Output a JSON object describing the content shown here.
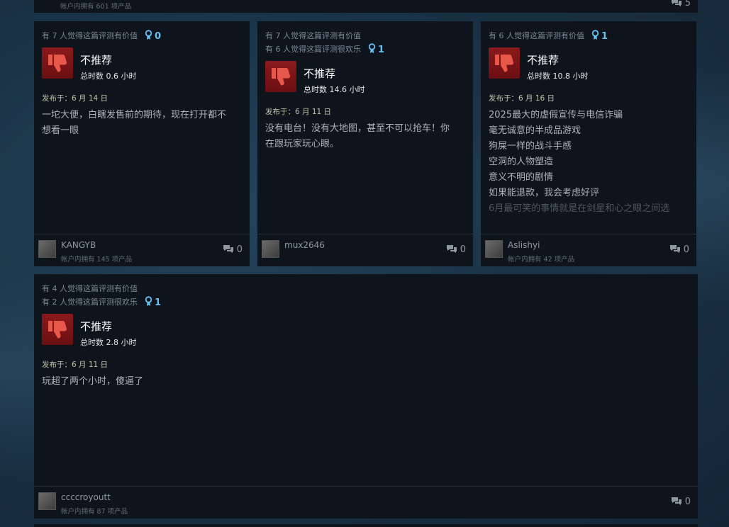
{
  "top_strip": {
    "owned": "帐户内拥有 601 项产品",
    "comment_count": "5"
  },
  "reviews": [
    {
      "helpful": "有 7 人觉得这篇评测有价值",
      "funny": "",
      "awards": "0",
      "verdict": "不推荐",
      "hours": "总时数 0.6 小时",
      "posted": "发布于：6 月 14 日",
      "lines": [
        "一坨大便，白瞎发售前的期待，现在打开都不",
        "想看一眼"
      ],
      "user": "KANGYB",
      "owned": "帐户内拥有 145 项产品",
      "comments": "0"
    },
    {
      "helpful": "有 7 人觉得这篇评测有价值",
      "funny": "有 6 人觉得这篇评测很欢乐",
      "awards": "1",
      "verdict": "不推荐",
      "hours": "总时数 14.6 小时",
      "posted": "发布于：6 月 11 日",
      "lines": [
        "没有电台！没有大地图，甚至不可以抢车！你",
        "在跟玩家玩心眼。"
      ],
      "user": "mux2646",
      "owned": "",
      "comments": "0"
    },
    {
      "helpful": "有 6 人觉得这篇评测有价值",
      "funny": "",
      "awards": "1",
      "verdict": "不推荐",
      "hours": "总时数 10.8 小时",
      "posted": "发布于：6 月 16 日",
      "lines": [
        "2025最大的虚假宣传与电信诈骗",
        "毫无诚意的半成品游戏",
        "狗屎一样的战斗手感",
        "空洞的人物塑造",
        "意义不明的剧情",
        "如果能退款，我会考虑好评",
        "6月最可笑的事情就是在剑星和心之眼之间选"
      ],
      "user": "Aslishyi",
      "owned": "帐户内拥有 42 项产品",
      "comments": "0"
    },
    {
      "helpful": "有 4 人觉得这篇评测有价值",
      "funny": "有 2 人觉得这篇评测很欢乐",
      "awards": "1",
      "verdict": "不推荐",
      "hours": "总时数 2.8 小时",
      "posted": "发布于：6 月 11 日",
      "lines": [
        "玩超了两个小时，傻逼了"
      ],
      "user": "ccccroyoutt",
      "owned": "帐户内拥有 87 项产品",
      "comments": "0"
    }
  ],
  "icons": {
    "thumb": "thumbs-down-icon",
    "award": "award-icon",
    "comment": "comment-icon"
  },
  "colors": {
    "accent": "#66c0f4",
    "thumb_bg": "#8b1a1c",
    "thumb_fg": "#e8584a"
  }
}
